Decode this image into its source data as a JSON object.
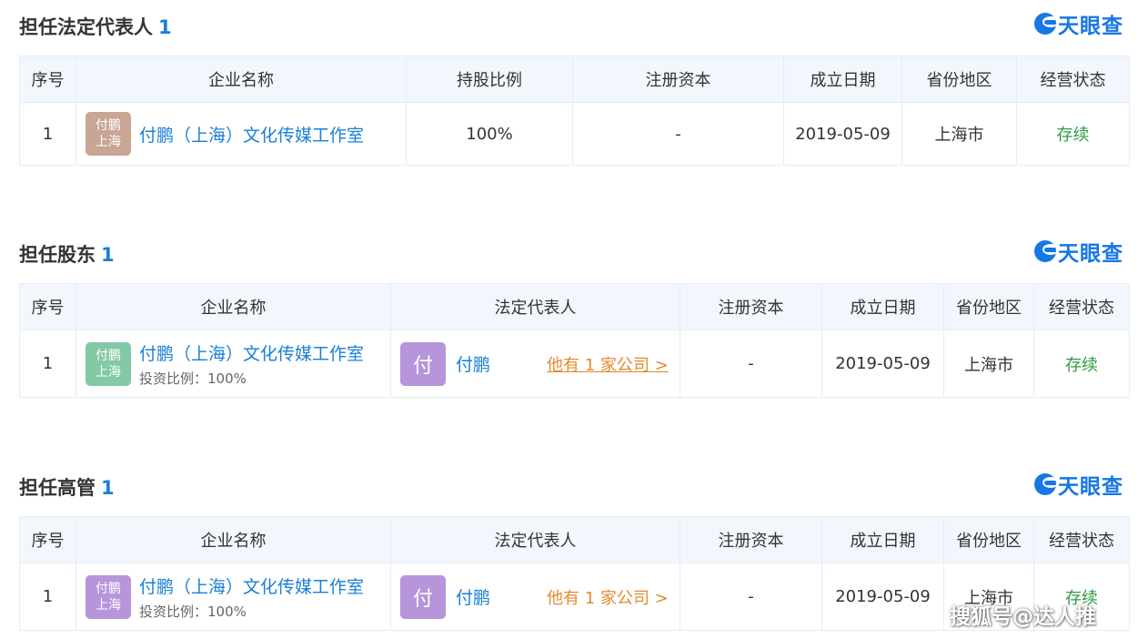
{
  "logo_text": "天眼查",
  "colors": {
    "accent": "#1a7fd4",
    "status": "#2d9b3f",
    "link_orange": "#e2892f",
    "avatar_brown": "#c9a594",
    "avatar_green": "#83c9a6",
    "avatar_purple": "#b695db"
  },
  "sections": [
    {
      "title": "担任法定代表人",
      "count": "1",
      "headers": [
        "序号",
        "企业名称",
        "持股比例",
        "注册资本",
        "成立日期",
        "省份地区",
        "经营状态"
      ],
      "row": {
        "index": "1",
        "avatar_line1": "付鹏",
        "avatar_line2": "上海",
        "company": "付鹏（上海）文化传媒工作室",
        "share_ratio": "100%",
        "capital": "-",
        "date": "2019-05-09",
        "region": "上海市",
        "status": "存续"
      }
    },
    {
      "title": "担任股东",
      "count": "1",
      "headers": [
        "序号",
        "企业名称",
        "法定代表人",
        "注册资本",
        "成立日期",
        "省份地区",
        "经营状态"
      ],
      "row": {
        "index": "1",
        "avatar_line1": "付鹏",
        "avatar_line2": "上海",
        "company": "付鹏（上海）文化传媒工作室",
        "invest_ratio": "投资比例：100%",
        "rep_avatar": "付",
        "rep_name": "付鹏",
        "rep_link": "他有 1 家公司 >",
        "capital": "-",
        "date": "2019-05-09",
        "region": "上海市",
        "status": "存续"
      }
    },
    {
      "title": "担任高管",
      "count": "1",
      "headers": [
        "序号",
        "企业名称",
        "法定代表人",
        "注册资本",
        "成立日期",
        "省份地区",
        "经营状态"
      ],
      "row": {
        "index": "1",
        "avatar_line1": "付鹏",
        "avatar_line2": "上海",
        "company": "付鹏（上海）文化传媒工作室",
        "invest_ratio": "投资比例：100%",
        "rep_avatar": "付",
        "rep_name": "付鹏",
        "rep_link": "他有 1 家公司 >",
        "capital": "-",
        "date": "2019-05-09",
        "region": "上海市",
        "status": "存续"
      }
    }
  ],
  "watermark": "搜狐号@达人推"
}
